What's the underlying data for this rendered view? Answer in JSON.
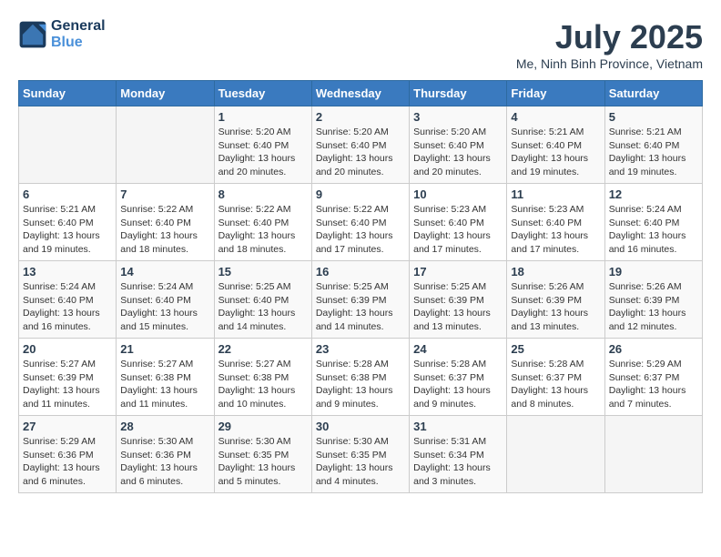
{
  "header": {
    "logo_line1": "General",
    "logo_line2": "Blue",
    "month_year": "July 2025",
    "location": "Me, Ninh Binh Province, Vietnam"
  },
  "weekdays": [
    "Sunday",
    "Monday",
    "Tuesday",
    "Wednesday",
    "Thursday",
    "Friday",
    "Saturday"
  ],
  "weeks": [
    [
      {
        "day": "",
        "sunrise": "",
        "sunset": "",
        "daylight": ""
      },
      {
        "day": "",
        "sunrise": "",
        "sunset": "",
        "daylight": ""
      },
      {
        "day": "1",
        "sunrise": "Sunrise: 5:20 AM",
        "sunset": "Sunset: 6:40 PM",
        "daylight": "Daylight: 13 hours and 20 minutes."
      },
      {
        "day": "2",
        "sunrise": "Sunrise: 5:20 AM",
        "sunset": "Sunset: 6:40 PM",
        "daylight": "Daylight: 13 hours and 20 minutes."
      },
      {
        "day": "3",
        "sunrise": "Sunrise: 5:20 AM",
        "sunset": "Sunset: 6:40 PM",
        "daylight": "Daylight: 13 hours and 20 minutes."
      },
      {
        "day": "4",
        "sunrise": "Sunrise: 5:21 AM",
        "sunset": "Sunset: 6:40 PM",
        "daylight": "Daylight: 13 hours and 19 minutes."
      },
      {
        "day": "5",
        "sunrise": "Sunrise: 5:21 AM",
        "sunset": "Sunset: 6:40 PM",
        "daylight": "Daylight: 13 hours and 19 minutes."
      }
    ],
    [
      {
        "day": "6",
        "sunrise": "Sunrise: 5:21 AM",
        "sunset": "Sunset: 6:40 PM",
        "daylight": "Daylight: 13 hours and 19 minutes."
      },
      {
        "day": "7",
        "sunrise": "Sunrise: 5:22 AM",
        "sunset": "Sunset: 6:40 PM",
        "daylight": "Daylight: 13 hours and 18 minutes."
      },
      {
        "day": "8",
        "sunrise": "Sunrise: 5:22 AM",
        "sunset": "Sunset: 6:40 PM",
        "daylight": "Daylight: 13 hours and 18 minutes."
      },
      {
        "day": "9",
        "sunrise": "Sunrise: 5:22 AM",
        "sunset": "Sunset: 6:40 PM",
        "daylight": "Daylight: 13 hours and 17 minutes."
      },
      {
        "day": "10",
        "sunrise": "Sunrise: 5:23 AM",
        "sunset": "Sunset: 6:40 PM",
        "daylight": "Daylight: 13 hours and 17 minutes."
      },
      {
        "day": "11",
        "sunrise": "Sunrise: 5:23 AM",
        "sunset": "Sunset: 6:40 PM",
        "daylight": "Daylight: 13 hours and 17 minutes."
      },
      {
        "day": "12",
        "sunrise": "Sunrise: 5:24 AM",
        "sunset": "Sunset: 6:40 PM",
        "daylight": "Daylight: 13 hours and 16 minutes."
      }
    ],
    [
      {
        "day": "13",
        "sunrise": "Sunrise: 5:24 AM",
        "sunset": "Sunset: 6:40 PM",
        "daylight": "Daylight: 13 hours and 16 minutes."
      },
      {
        "day": "14",
        "sunrise": "Sunrise: 5:24 AM",
        "sunset": "Sunset: 6:40 PM",
        "daylight": "Daylight: 13 hours and 15 minutes."
      },
      {
        "day": "15",
        "sunrise": "Sunrise: 5:25 AM",
        "sunset": "Sunset: 6:40 PM",
        "daylight": "Daylight: 13 hours and 14 minutes."
      },
      {
        "day": "16",
        "sunrise": "Sunrise: 5:25 AM",
        "sunset": "Sunset: 6:39 PM",
        "daylight": "Daylight: 13 hours and 14 minutes."
      },
      {
        "day": "17",
        "sunrise": "Sunrise: 5:25 AM",
        "sunset": "Sunset: 6:39 PM",
        "daylight": "Daylight: 13 hours and 13 minutes."
      },
      {
        "day": "18",
        "sunrise": "Sunrise: 5:26 AM",
        "sunset": "Sunset: 6:39 PM",
        "daylight": "Daylight: 13 hours and 13 minutes."
      },
      {
        "day": "19",
        "sunrise": "Sunrise: 5:26 AM",
        "sunset": "Sunset: 6:39 PM",
        "daylight": "Daylight: 13 hours and 12 minutes."
      }
    ],
    [
      {
        "day": "20",
        "sunrise": "Sunrise: 5:27 AM",
        "sunset": "Sunset: 6:39 PM",
        "daylight": "Daylight: 13 hours and 11 minutes."
      },
      {
        "day": "21",
        "sunrise": "Sunrise: 5:27 AM",
        "sunset": "Sunset: 6:38 PM",
        "daylight": "Daylight: 13 hours and 11 minutes."
      },
      {
        "day": "22",
        "sunrise": "Sunrise: 5:27 AM",
        "sunset": "Sunset: 6:38 PM",
        "daylight": "Daylight: 13 hours and 10 minutes."
      },
      {
        "day": "23",
        "sunrise": "Sunrise: 5:28 AM",
        "sunset": "Sunset: 6:38 PM",
        "daylight": "Daylight: 13 hours and 9 minutes."
      },
      {
        "day": "24",
        "sunrise": "Sunrise: 5:28 AM",
        "sunset": "Sunset: 6:37 PM",
        "daylight": "Daylight: 13 hours and 9 minutes."
      },
      {
        "day": "25",
        "sunrise": "Sunrise: 5:28 AM",
        "sunset": "Sunset: 6:37 PM",
        "daylight": "Daylight: 13 hours and 8 minutes."
      },
      {
        "day": "26",
        "sunrise": "Sunrise: 5:29 AM",
        "sunset": "Sunset: 6:37 PM",
        "daylight": "Daylight: 13 hours and 7 minutes."
      }
    ],
    [
      {
        "day": "27",
        "sunrise": "Sunrise: 5:29 AM",
        "sunset": "Sunset: 6:36 PM",
        "daylight": "Daylight: 13 hours and 6 minutes."
      },
      {
        "day": "28",
        "sunrise": "Sunrise: 5:30 AM",
        "sunset": "Sunset: 6:36 PM",
        "daylight": "Daylight: 13 hours and 6 minutes."
      },
      {
        "day": "29",
        "sunrise": "Sunrise: 5:30 AM",
        "sunset": "Sunset: 6:35 PM",
        "daylight": "Daylight: 13 hours and 5 minutes."
      },
      {
        "day": "30",
        "sunrise": "Sunrise: 5:30 AM",
        "sunset": "Sunset: 6:35 PM",
        "daylight": "Daylight: 13 hours and 4 minutes."
      },
      {
        "day": "31",
        "sunrise": "Sunrise: 5:31 AM",
        "sunset": "Sunset: 6:34 PM",
        "daylight": "Daylight: 13 hours and 3 minutes."
      },
      {
        "day": "",
        "sunrise": "",
        "sunset": "",
        "daylight": ""
      },
      {
        "day": "",
        "sunrise": "",
        "sunset": "",
        "daylight": ""
      }
    ]
  ]
}
